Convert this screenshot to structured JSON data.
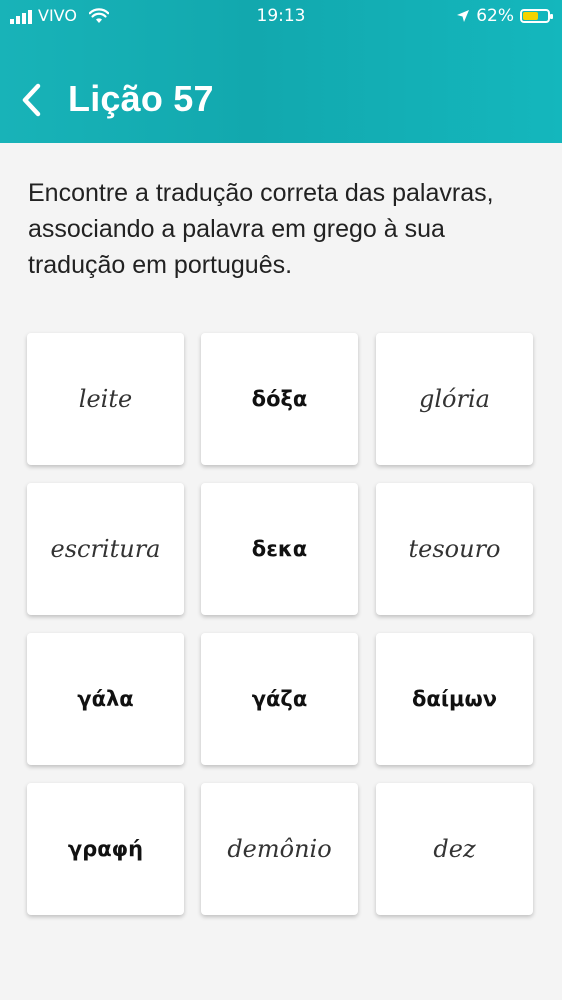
{
  "status_bar": {
    "carrier": "VIVO",
    "time": "19:13",
    "battery_percent": "62%",
    "battery_level": 0.62,
    "battery_color": "#f5d300"
  },
  "header": {
    "title": "Lição 57",
    "back_icon": "chevron-left-icon",
    "background_colors": [
      "#18b3b8",
      "#12a8ae",
      "#14b7bd"
    ]
  },
  "instruction": "Encontre a tradução correta das palavras, associando a palavra em grego à sua tradução em português.",
  "cards": [
    {
      "text": "leite",
      "lang": "pt"
    },
    {
      "text": "δόξα",
      "lang": "gr"
    },
    {
      "text": "glória",
      "lang": "pt"
    },
    {
      "text": "escritura",
      "lang": "pt"
    },
    {
      "text": "δεκα",
      "lang": "gr"
    },
    {
      "text": "tesouro",
      "lang": "pt"
    },
    {
      "text": "γάλα",
      "lang": "gr"
    },
    {
      "text": "γάζα",
      "lang": "gr"
    },
    {
      "text": "δαίμων",
      "lang": "gr"
    },
    {
      "text": "γραφή",
      "lang": "gr"
    },
    {
      "text": "demônio",
      "lang": "pt"
    },
    {
      "text": "dez",
      "lang": "pt"
    }
  ]
}
